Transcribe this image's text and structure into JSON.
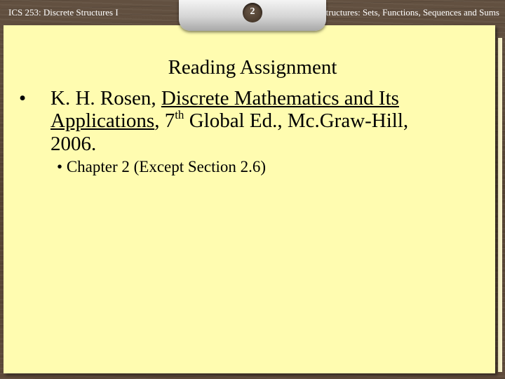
{
  "header": {
    "course": "ICS 253: Discrete Structures I",
    "page_number": "2",
    "topic": "Basic Structures: Sets, Functions, Sequences and Sums"
  },
  "slide": {
    "title": "Reading Assignment",
    "bullets": [
      {
        "marker": "•",
        "author": "K. H. Rosen, ",
        "book_title": "Discrete Mathematics and Its Applications",
        "after_title": ", 7",
        "superscript": "th",
        "rest": " Global Ed., Mc.Graw-Hill, 2006."
      }
    ],
    "sub_bullets": [
      {
        "marker": "•",
        "text": "Chapter 2 (Except Section 2.6)"
      }
    ]
  },
  "colors": {
    "paper": "#fffcb0",
    "background": "#5a4636"
  }
}
